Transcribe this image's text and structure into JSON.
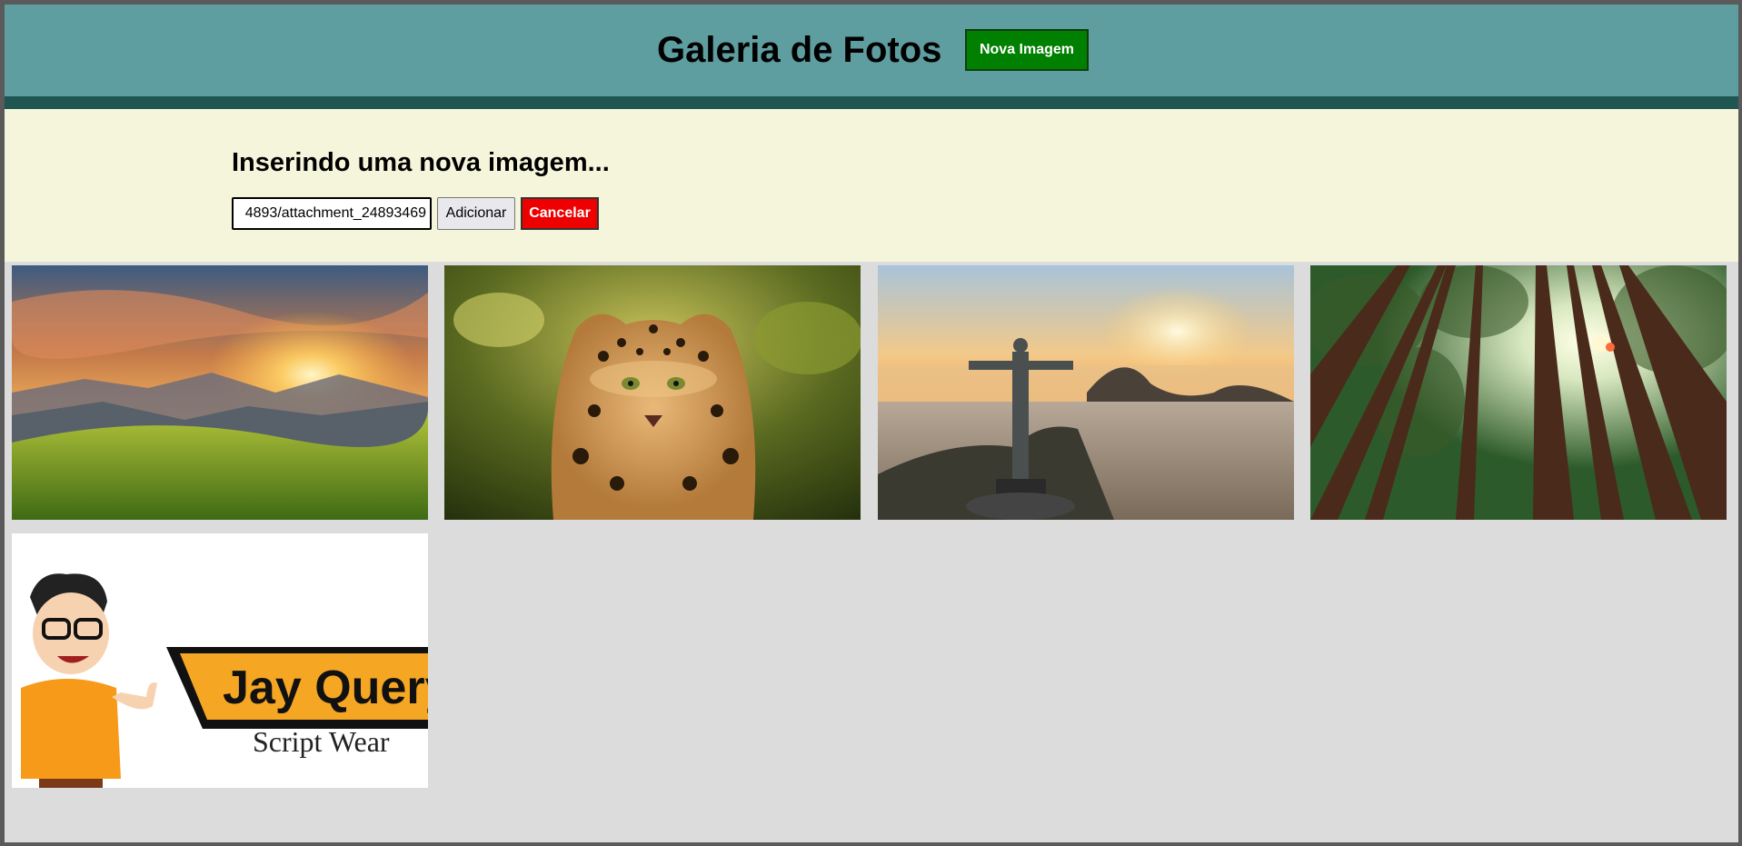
{
  "header": {
    "title": "Galeria de Fotos",
    "new_image_button": "Nova Imagem"
  },
  "form": {
    "title": "Inserindo uma nova imagem...",
    "url_value": "4893/attachment_24893469",
    "add_button": "Adicionar",
    "cancel_button": "Cancelar"
  },
  "gallery": {
    "images": [
      {
        "name": "mountain-sunset"
      },
      {
        "name": "jaguar"
      },
      {
        "name": "christ-the-redeemer"
      },
      {
        "name": "forest-canopy"
      },
      {
        "name": "jay-query-logo",
        "logo_text": "Jay Query",
        "logo_subtext": "Script Wear"
      }
    ]
  },
  "colors": {
    "header_bg": "#5f9ea0",
    "header_border": "#1f5652",
    "form_bg": "#f5f5dc",
    "page_bg": "#dcdcdc",
    "new_button": "#008000",
    "cancel_button": "#ee0000"
  }
}
